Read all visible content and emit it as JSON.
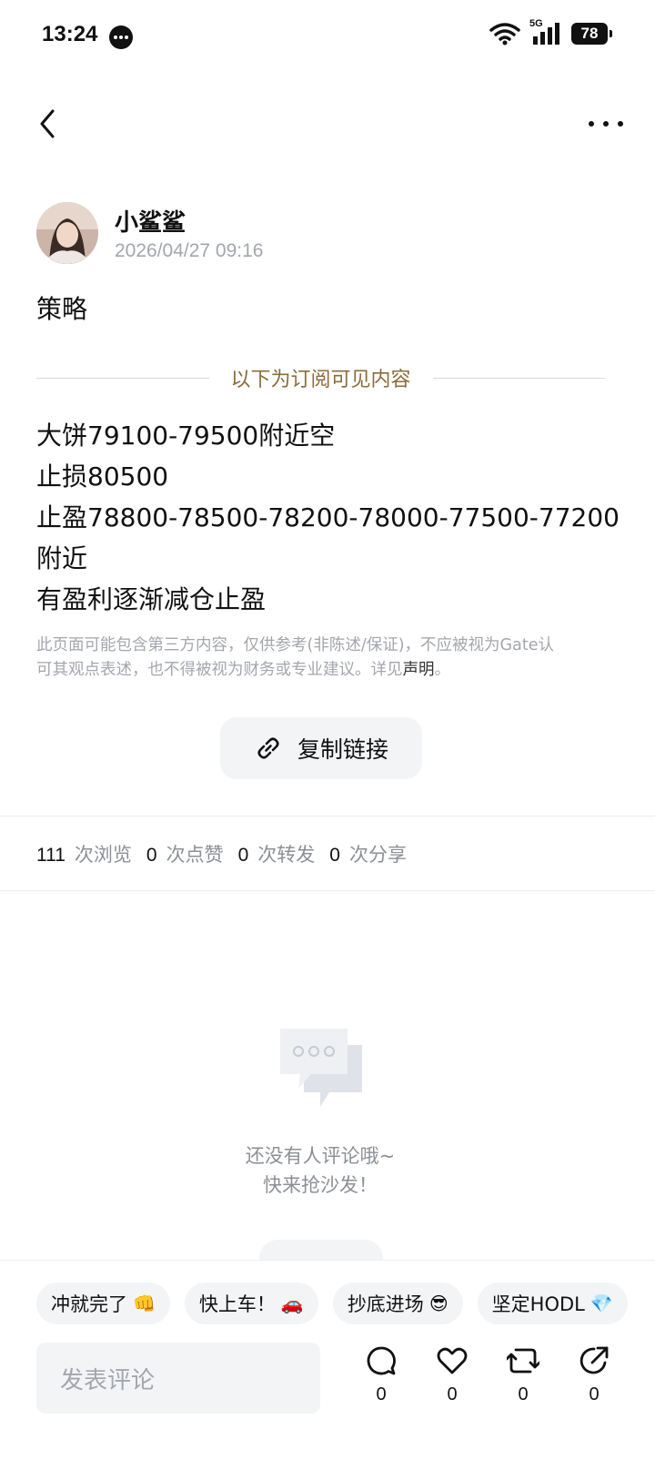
{
  "status_bar": {
    "time": "13:24",
    "network": "5G",
    "battery": "78",
    "icons": [
      "message-icon",
      "wifi-icon",
      "signal-icon",
      "battery-icon"
    ]
  },
  "nav": {
    "back_icon": "chevron-left-icon",
    "more_icon": "more-dots-icon"
  },
  "author": {
    "name": "小鲨鲨",
    "time": "2026/04/27 09:16"
  },
  "post": {
    "title": "策略",
    "subscription_divider": "以下为订阅可见内容",
    "lines": [
      "大饼79100-79500附近空",
      "止损80500",
      "止盈78800-78500-78200-78000-77500-77200",
      "附近",
      "有盈利逐渐减仓止盈"
    ],
    "disclaimer_line1": "此页面可能包含第三方内容，仅供参考(非陈述/保证)，不应被视为Gate认",
    "disclaimer_line2": "可其观点表述，也不得被视为财务或专业建议。详见",
    "disclaimer_link": "声明",
    "disclaimer_end": "。"
  },
  "copy_link": {
    "label": "复制链接",
    "icon": "link-icon"
  },
  "stats": [
    {
      "count": "111",
      "label": "次浏览"
    },
    {
      "count": "0",
      "label": "次点赞"
    },
    {
      "count": "0",
      "label": "次转发"
    },
    {
      "count": "0",
      "label": "次分享"
    }
  ],
  "comments": {
    "empty_icon": "comment-bubble-icon",
    "empty_line1": "还没有人评论哦~",
    "empty_line2": "快来抢沙发！"
  },
  "quick_replies": [
    {
      "label": "冲就完了",
      "emoji": "👊"
    },
    {
      "label": "快上车！",
      "emoji": "🚗"
    },
    {
      "label": "抄底进场",
      "emoji": "😎"
    },
    {
      "label": "坚定HODL",
      "emoji": "💎"
    }
  ],
  "composer": {
    "placeholder": "发表评论",
    "actions": [
      {
        "icon": "comment-icon",
        "count": "0"
      },
      {
        "icon": "heart-icon",
        "count": "0"
      },
      {
        "icon": "repost-icon",
        "count": "0"
      },
      {
        "icon": "share-icon",
        "count": "0"
      }
    ]
  },
  "colors": {
    "accent_gold": "#8a6d3b",
    "muted_text": "#a3a6ad",
    "chip_bg": "#f3f4f6"
  }
}
